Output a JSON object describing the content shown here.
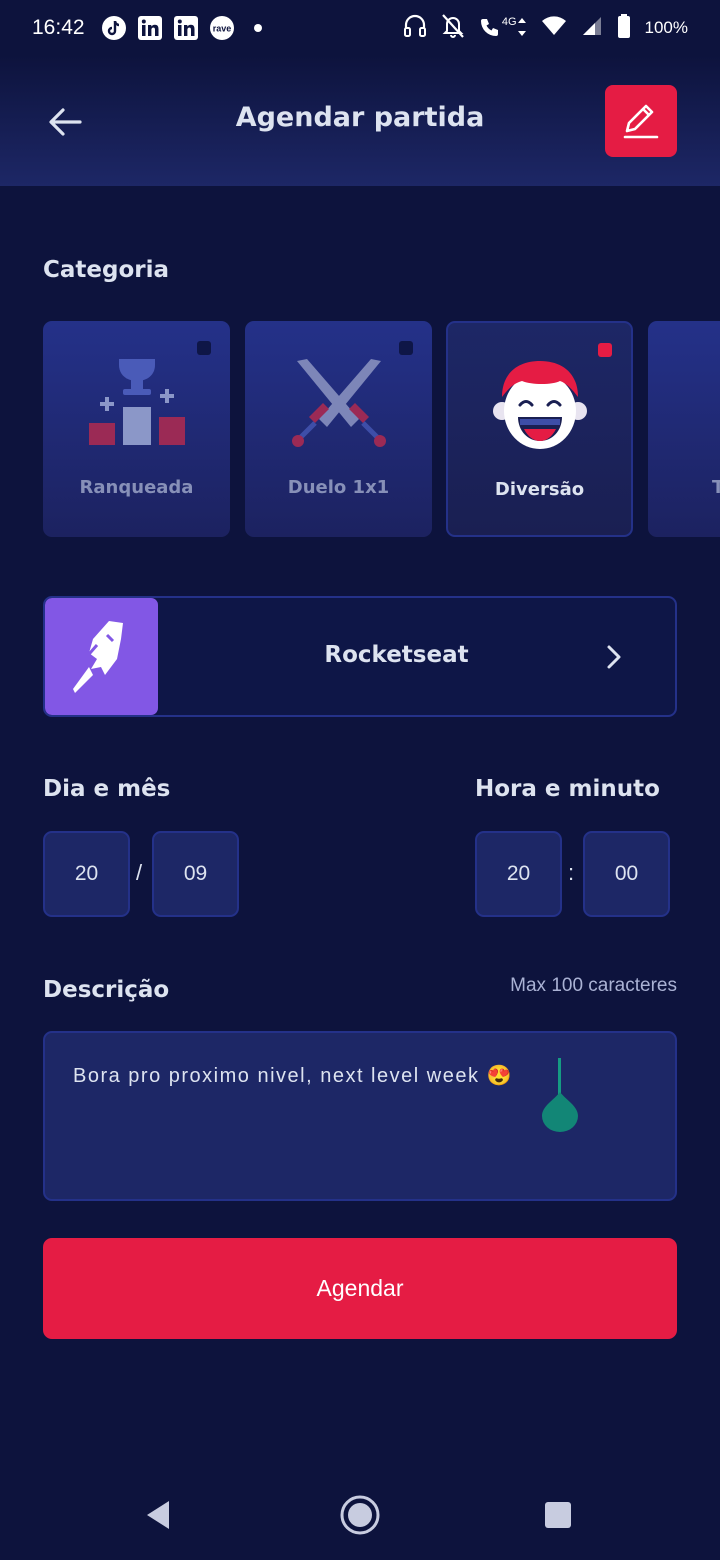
{
  "status_bar": {
    "time": "16:42",
    "left_icons": [
      "tiktok-icon",
      "linkedin-icon",
      "linkedin-icon",
      "rave-icon",
      "dot-icon"
    ],
    "right_icons": [
      "headphones-icon",
      "bell-off-icon",
      "wifi-calling-icon",
      "wifi-icon",
      "signal-icon",
      "battery-icon"
    ],
    "network_label": "4G",
    "battery": "100%"
  },
  "header": {
    "title": "Agendar partida",
    "back_icon": "arrow-left-icon",
    "action_icon": "pencil-icon"
  },
  "category": {
    "label": "Categoria",
    "items": [
      {
        "label": "Ranqueada",
        "icon": "trophy-podium-icon",
        "selected": false
      },
      {
        "label": "Duelo 1x1",
        "icon": "crossed-swords-icon",
        "selected": false
      },
      {
        "label": "Diversão",
        "icon": "laughing-face-icon",
        "selected": true
      },
      {
        "label": "T",
        "icon": "controller-icon",
        "selected": false
      }
    ]
  },
  "guild": {
    "name": "Rocketseat",
    "icon": "rocketseat-logo-icon",
    "chevron": "chevron-right-icon"
  },
  "date": {
    "label": "Dia e mês",
    "day": "20",
    "separator": "/",
    "month": "09"
  },
  "time": {
    "label": "Hora e minuto",
    "hour": "20",
    "separator": ":",
    "minute": "00"
  },
  "description": {
    "label": "Descrição",
    "max_hint": "Max 100 caracteres",
    "value": "Bora pro proximo nivel, next level week 😍"
  },
  "submit": {
    "label": "Agendar"
  },
  "colors": {
    "background": "#0d133d",
    "accent": "#e51c44",
    "card": "#1d2766",
    "border": "#243189",
    "guild": "#8257e5"
  }
}
